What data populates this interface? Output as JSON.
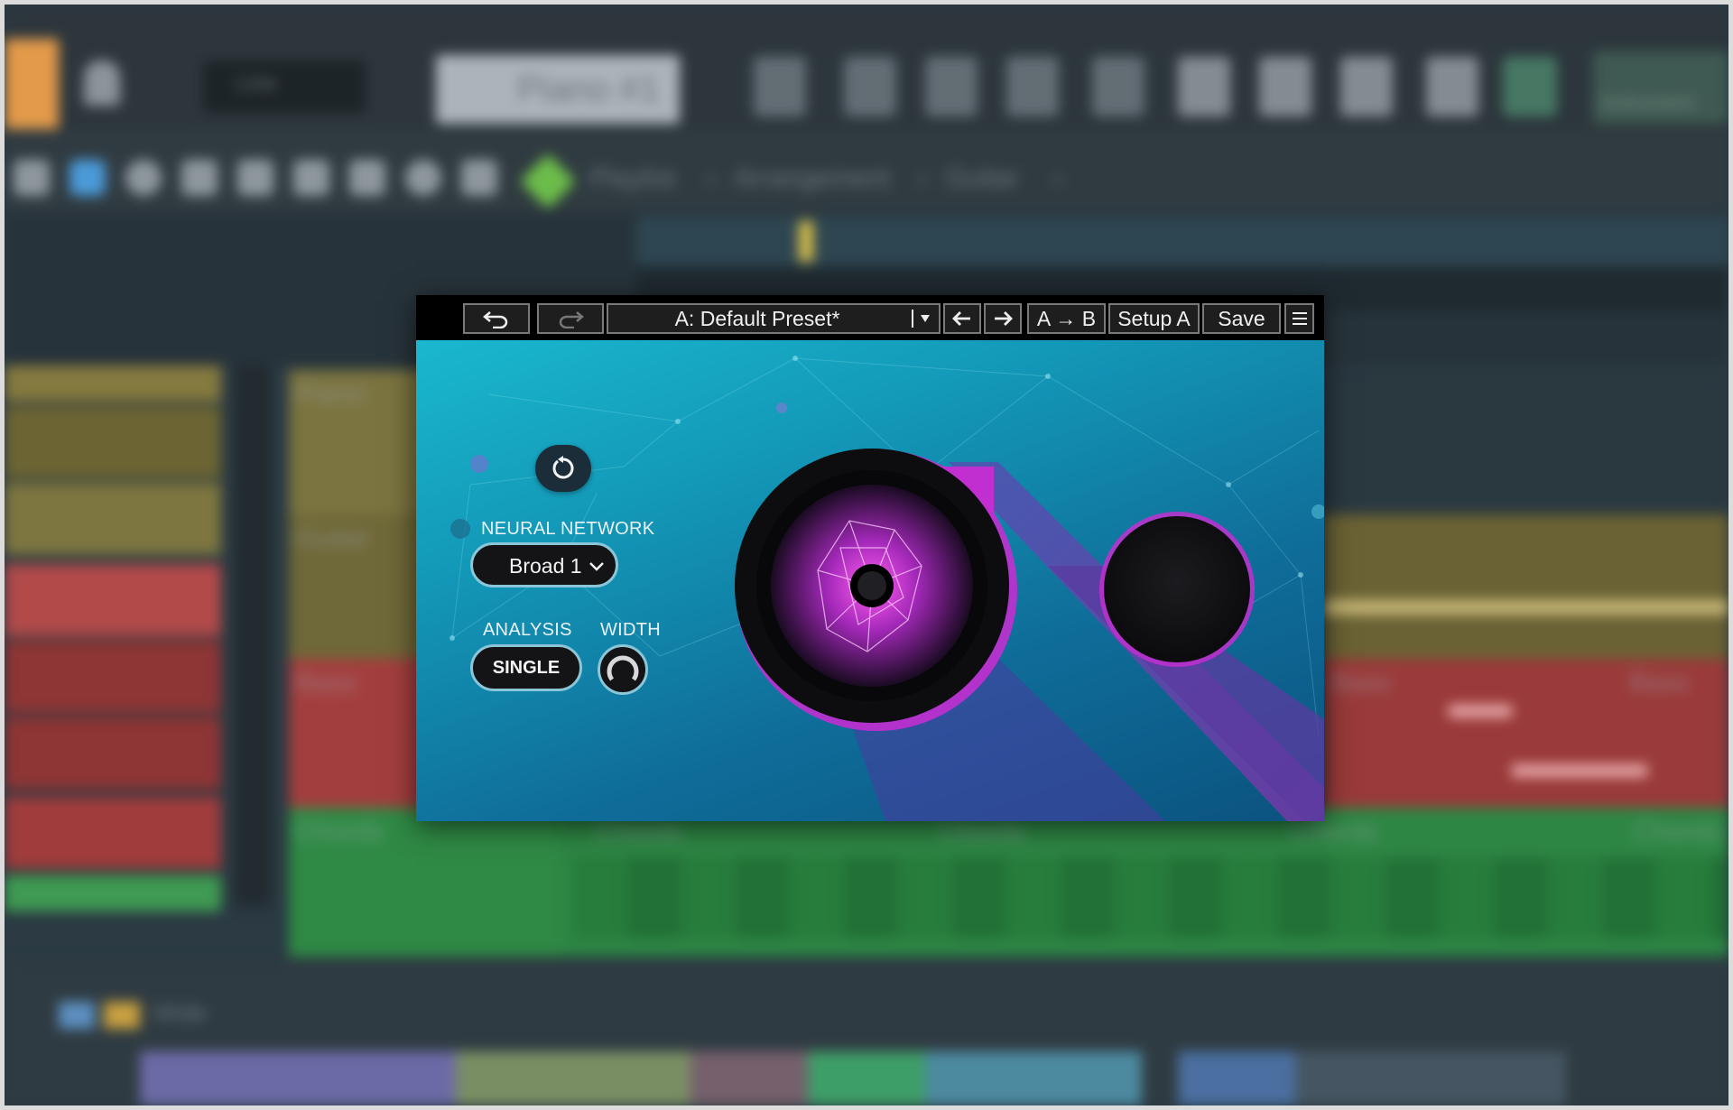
{
  "daw": {
    "patterns_label": "Line",
    "channel_name": "Piano #1",
    "breadcrumb": {
      "root": "Playlist",
      "sep1": "›",
      "section": "Arrangement",
      "sep2": "›",
      "track": "Guitar",
      "sep3": "›"
    },
    "tracks": [
      "Piano",
      "Guitar",
      "Bass",
      "Chords"
    ],
    "clip_labels": [
      "Chords",
      "Chords",
      "Chords",
      "Chords",
      "Bass",
      "Bass"
    ],
    "mixer_label": "Wide",
    "right_readout": "Instrument"
  },
  "plugin": {
    "preset_name": "A: Default Preset*",
    "ab_label": "A → B",
    "setup_label": "Setup A",
    "save_label": "Save",
    "neural_network_label": "NEURAL NETWORK",
    "neural_network_value": "Broad 1",
    "analysis_label": "ANALYSIS",
    "analysis_value": "SINGLE",
    "width_label": "WIDTH",
    "width_value": 0.5
  },
  "colors": {
    "accent_magenta": "#c22fd0",
    "canvas_teal": "#14a6c2",
    "shape_purple": "#5b3ba0"
  }
}
